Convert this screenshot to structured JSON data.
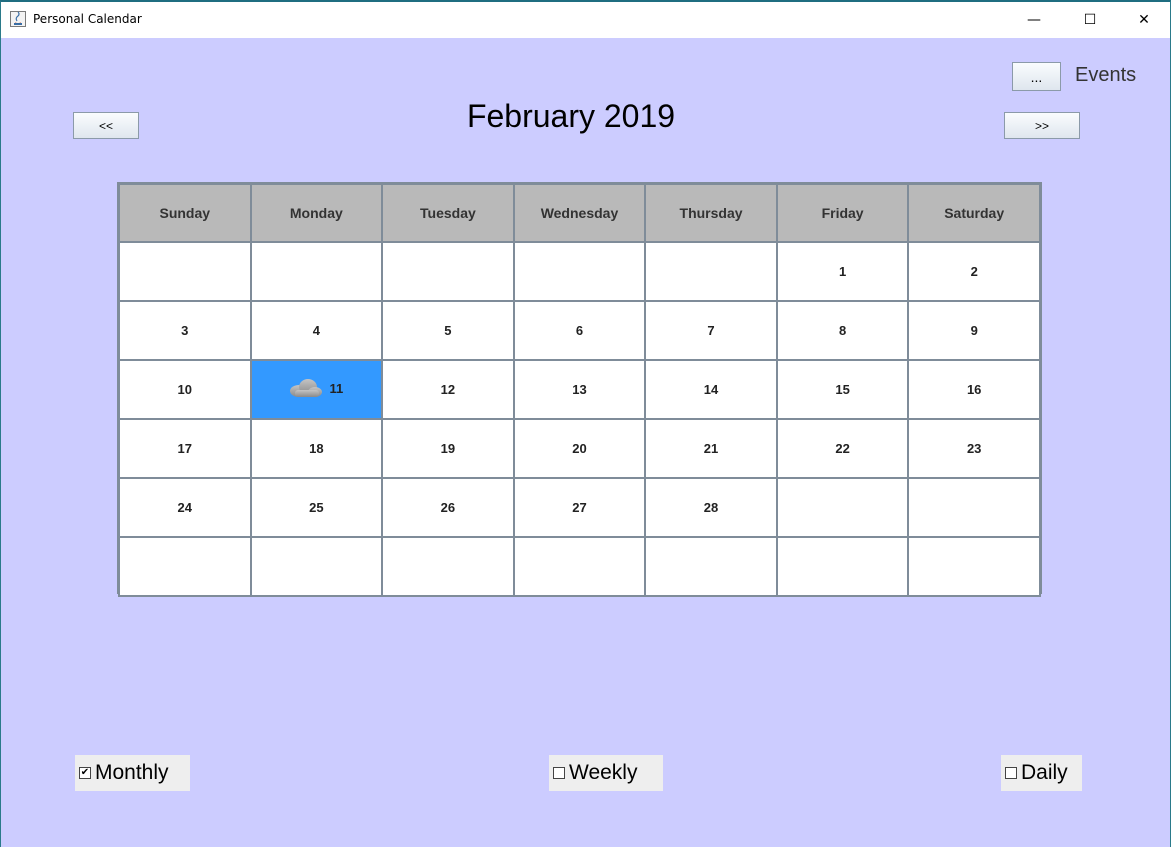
{
  "window": {
    "title": "Personal Calendar",
    "minimize_glyph": "—",
    "maximize_glyph": "☐",
    "close_glyph": "✕"
  },
  "nav": {
    "prev_label": "<<",
    "next_label": ">>",
    "events_button_label": "...",
    "events_label": "Events"
  },
  "calendar": {
    "month_title": "February 2019",
    "weekdays": [
      "Sunday",
      "Monday",
      "Tuesday",
      "Wednesday",
      "Thursday",
      "Friday",
      "Saturday"
    ],
    "weeks": [
      [
        "",
        "",
        "",
        "",
        "",
        "1",
        "2"
      ],
      [
        "3",
        "4",
        "5",
        "6",
        "7",
        "8",
        "9"
      ],
      [
        "10",
        "11",
        "12",
        "13",
        "14",
        "15",
        "16"
      ],
      [
        "17",
        "18",
        "19",
        "20",
        "21",
        "22",
        "23"
      ],
      [
        "24",
        "25",
        "26",
        "27",
        "28",
        "",
        ""
      ],
      [
        "",
        "",
        "",
        "",
        "",
        "",
        ""
      ]
    ],
    "selected_day": "11",
    "selected_day_icon": "cloud-icon",
    "selected_color": "#3399ff",
    "header_color": "#b9b9b9",
    "background_color": "#ccccff"
  },
  "view_options": {
    "monthly": {
      "label": "Monthly",
      "checked": true
    },
    "weekly": {
      "label": "Weekly",
      "checked": false
    },
    "daily": {
      "label": "Daily",
      "checked": false
    }
  }
}
